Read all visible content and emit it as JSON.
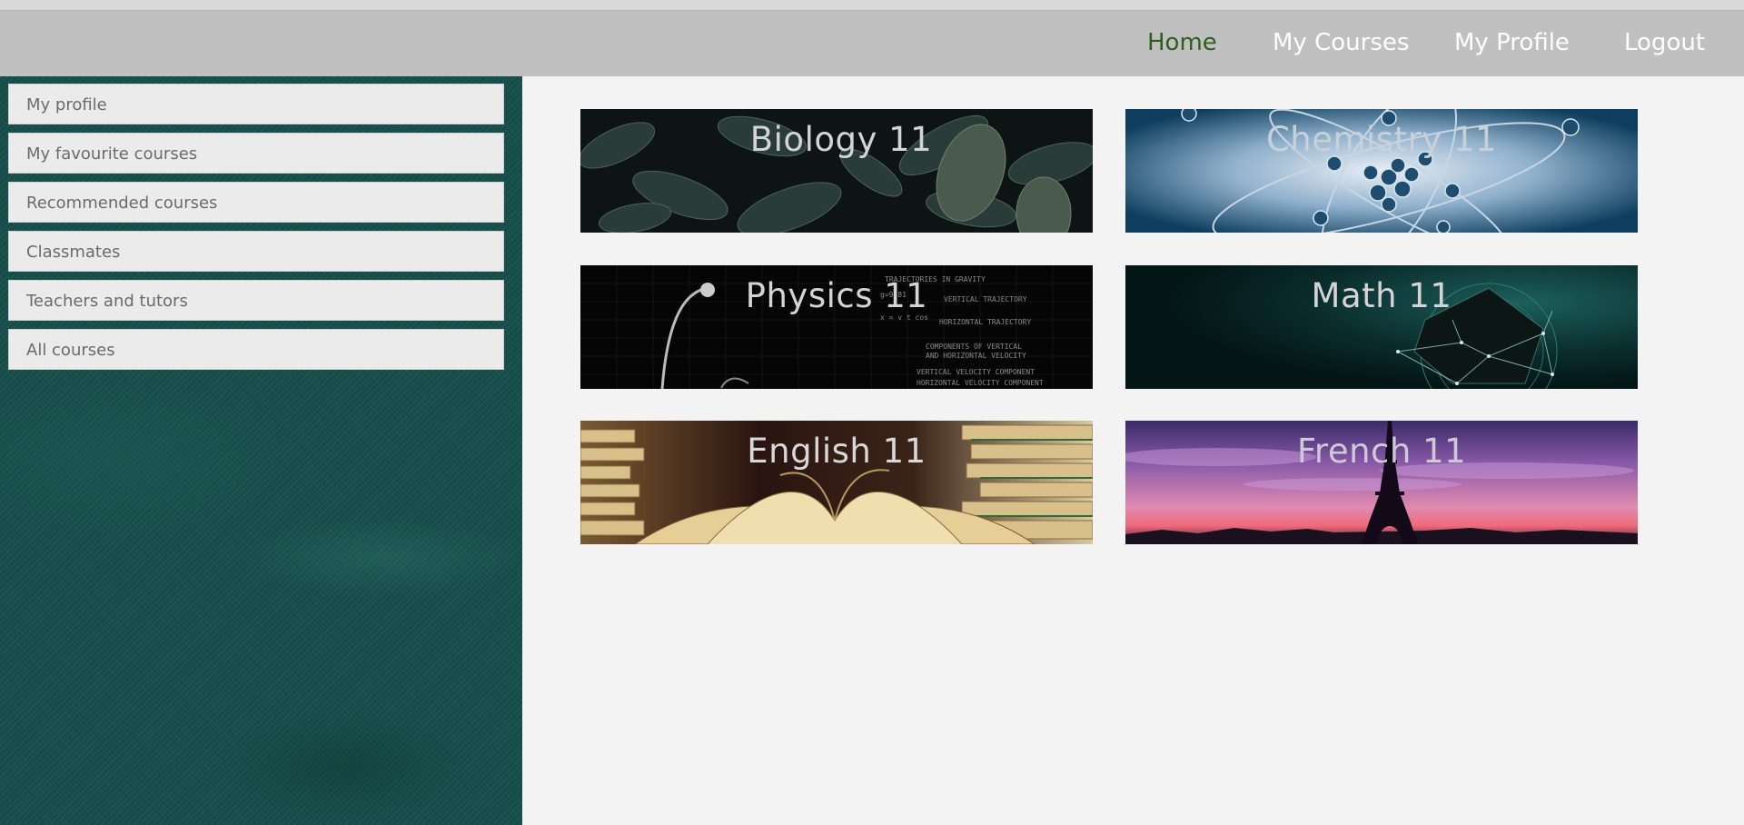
{
  "nav": {
    "items": [
      {
        "label": "Home",
        "active": true
      },
      {
        "label": "My Courses"
      },
      {
        "label": "My Profile"
      },
      {
        "label": "Logout"
      }
    ],
    "active_color": "#2f5d1f",
    "bar_color": "#c0c0c0"
  },
  "sidebar": {
    "background_color": "#144e4a",
    "items": [
      {
        "label": "My profile"
      },
      {
        "label": "My favourite courses"
      },
      {
        "label": "Recommended courses"
      },
      {
        "label": "Classmates"
      },
      {
        "label": "Teachers and tutors"
      },
      {
        "label": "All courses"
      }
    ]
  },
  "courses": [
    {
      "title": "Biology 11",
      "image": "leaves"
    },
    {
      "title": "Chemistry 11",
      "image": "molecule"
    },
    {
      "title": "Physics 11",
      "image": "chalkboard"
    },
    {
      "title": "Math 11",
      "image": "geometric-shape"
    },
    {
      "title": "English 11",
      "image": "open-book"
    },
    {
      "title": "French 11",
      "image": "eiffel-tower-sunset"
    }
  ]
}
